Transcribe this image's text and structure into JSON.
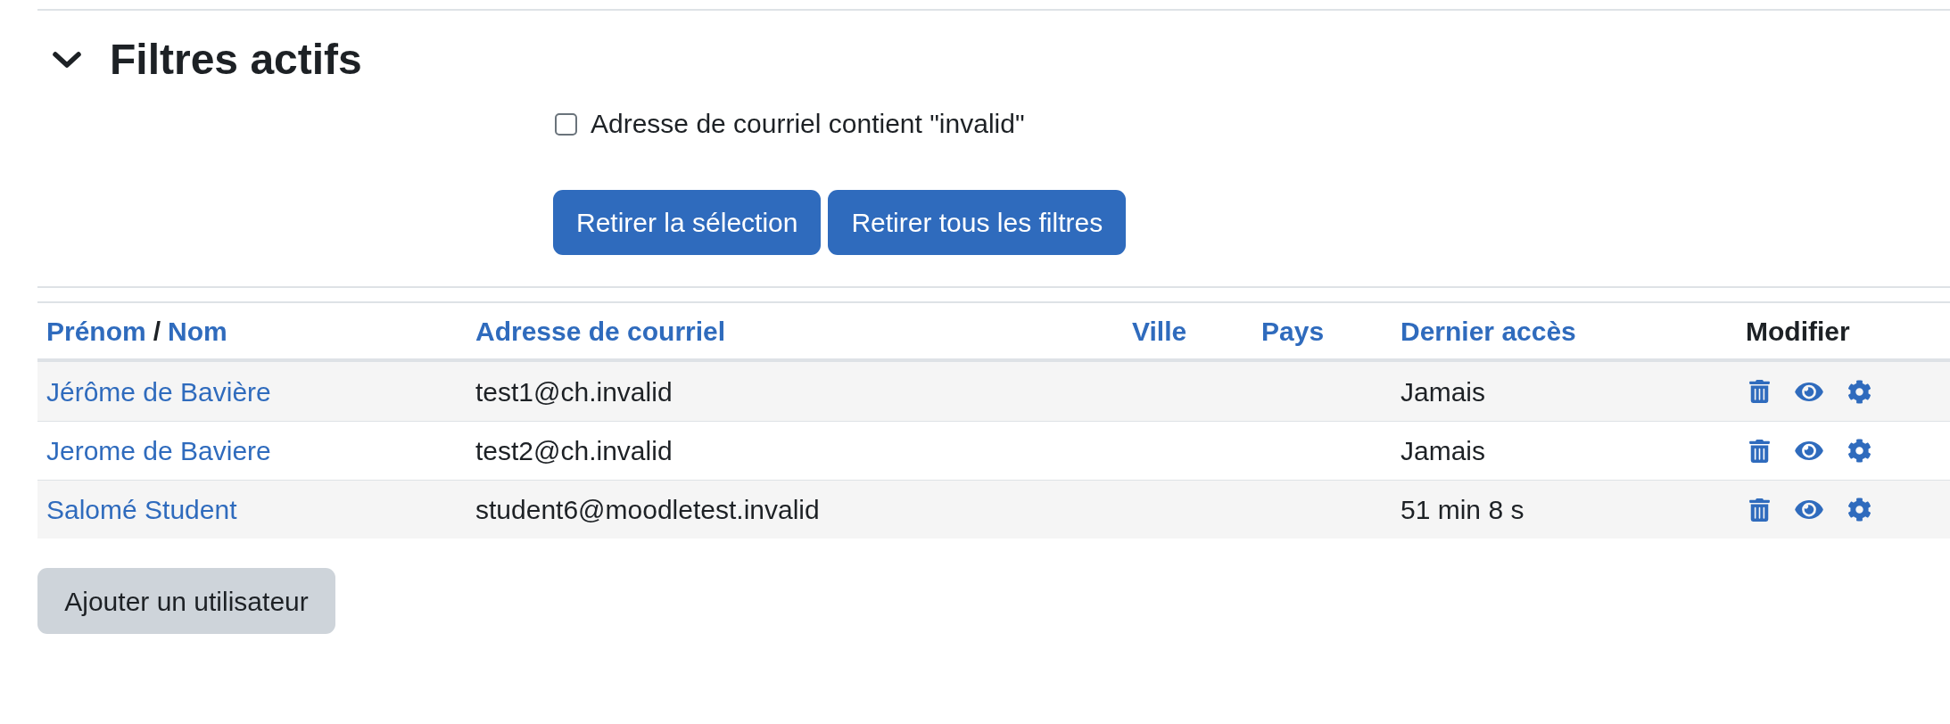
{
  "section": {
    "title": "Filtres actifs",
    "expanded": true
  },
  "filters": [
    {
      "label": "Adresse de courriel contient \"invalid\"",
      "checked": false
    }
  ],
  "filter_buttons": [
    {
      "label": "Retirer la sélection"
    },
    {
      "label": "Retirer tous les filtres"
    }
  ],
  "table": {
    "columns": [
      {
        "kind": "pair",
        "parts": [
          "Prénom",
          "Nom"
        ],
        "separator": "/",
        "link": true
      },
      {
        "kind": "single",
        "label": "Adresse de courriel",
        "link": true
      },
      {
        "kind": "single",
        "label": "Ville",
        "link": true
      },
      {
        "kind": "single",
        "label": "Pays",
        "link": true
      },
      {
        "kind": "single",
        "label": "Dernier accès",
        "link": true
      },
      {
        "kind": "single",
        "label": "Modifier",
        "link": false
      }
    ],
    "rows": [
      {
        "name": "Jérôme de Bavière",
        "email": "test1@ch.invalid",
        "last_access": "Jamais"
      },
      {
        "name": "Jerome de Baviere",
        "email": "test2@ch.invalid",
        "last_access": "Jamais"
      },
      {
        "name": "Salomé Student",
        "email": "student6@moodletest.invalid",
        "last_access": "51 min 8 s"
      }
    ]
  },
  "add_button": {
    "label": "Ajouter un utilisateur"
  }
}
